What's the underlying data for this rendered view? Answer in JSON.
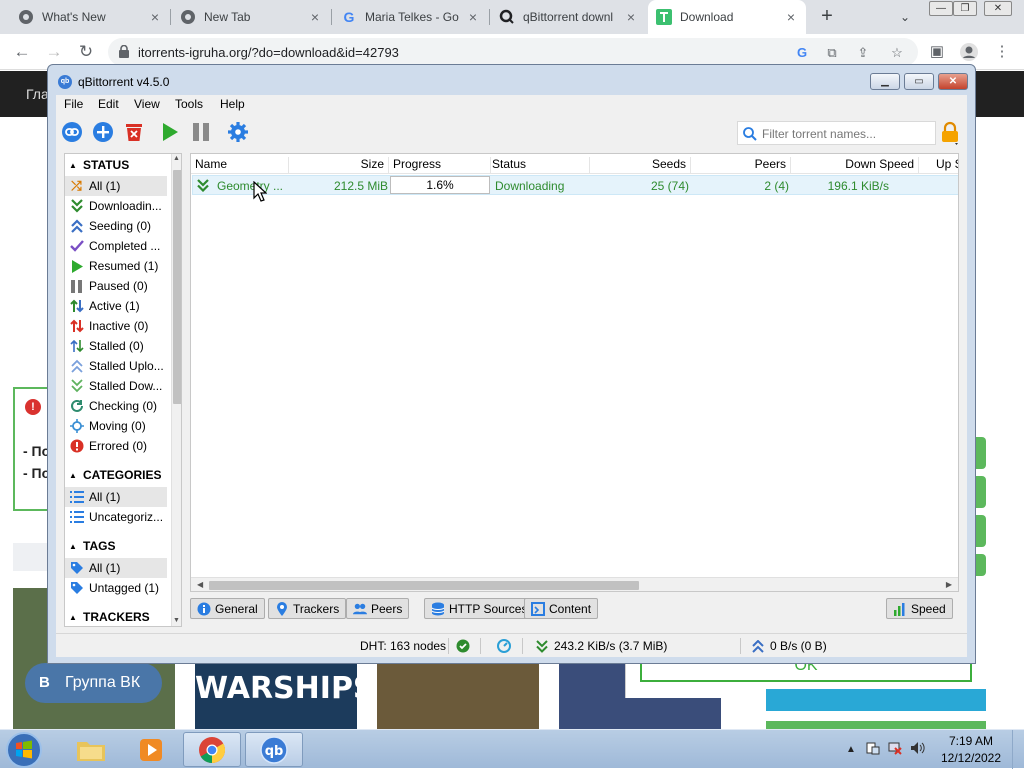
{
  "browser": {
    "tabs": [
      {
        "title": "What's New",
        "icon": "chrome-icon"
      },
      {
        "title": "New Tab",
        "icon": "chrome-icon"
      },
      {
        "title": "Maria Telkes - Go",
        "icon": "google-icon"
      },
      {
        "title": "qBittorrent downl",
        "icon": "search-icon"
      },
      {
        "title": "Download",
        "icon": "site-icon"
      }
    ],
    "new_tab_label": "+",
    "tab_menu_label": "⌄",
    "url": "itorrents-igruha.org/?do=download&id=42793"
  },
  "webpage": {
    "nav_text": "Гла",
    "err_lines": [
      "- По",
      "- По"
    ],
    "vk_label": "Группа ВК",
    "vk_icon": "В",
    "warships": "WARSHIPS",
    "ok_label": "OK"
  },
  "qb": {
    "title": "qBittorrent v4.5.0",
    "menu": [
      "File",
      "Edit",
      "View",
      "Tools",
      "Help"
    ],
    "filter_placeholder": "Filter torrent names...",
    "sidebar": {
      "status_header": "STATUS",
      "status_items": [
        {
          "label": "All (1)",
          "icon": "all-icon",
          "color": "#d97a00"
        },
        {
          "label": "Downloadin...",
          "icon": "download-icon",
          "color": "#2e8b2e"
        },
        {
          "label": "Seeding (0)",
          "icon": "upload-icon",
          "color": "#3a6fc4"
        },
        {
          "label": "Completed ...",
          "icon": "check-icon",
          "color": "#7a4fc4"
        },
        {
          "label": "Resumed (1)",
          "icon": "play-icon",
          "color": "#2eaa2e"
        },
        {
          "label": "Paused (0)",
          "icon": "pause-icon",
          "color": "#777777"
        },
        {
          "label": "Active (1)",
          "icon": "active-icon",
          "color": "#2e8b2e"
        },
        {
          "label": "Inactive (0)",
          "icon": "inactive-icon",
          "color": "#d93025"
        },
        {
          "label": "Stalled (0)",
          "icon": "stalled-icon",
          "color": "#2e8b2e"
        },
        {
          "label": "Stalled Uplo...",
          "icon": "stalled-upload-icon",
          "color": "#3a6fc4"
        },
        {
          "label": "Stalled Dow...",
          "icon": "stalled-download-icon",
          "color": "#2e8b2e"
        },
        {
          "label": "Checking (0)",
          "icon": "checking-icon",
          "color": "#2e8b6e"
        },
        {
          "label": "Moving (0)",
          "icon": "moving-icon",
          "color": "#3a8fd4"
        },
        {
          "label": "Errored (0)",
          "icon": "error-icon",
          "color": "#d93025"
        }
      ],
      "categories_header": "CATEGORIES",
      "categories_items": [
        {
          "label": "All (1)",
          "icon": "list-icon"
        },
        {
          "label": "Uncategoriz...",
          "icon": "list-icon"
        }
      ],
      "tags_header": "TAGS",
      "tags_items": [
        {
          "label": "All (1)",
          "icon": "tag-icon"
        },
        {
          "label": "Untagged (1)",
          "icon": "tag-icon"
        }
      ],
      "trackers_header": "TRACKERS"
    },
    "table": {
      "columns": [
        "Name",
        "Size",
        "Progress",
        "Status",
        "Seeds",
        "Peers",
        "Down Speed",
        "Up S"
      ],
      "rows": [
        {
          "name": "Geometry ...",
          "size": "212.5 MiB",
          "progress": "1.6%",
          "status": "Downloading",
          "seeds": "25 (74)",
          "peers": "2 (4)",
          "down_speed": "196.1 KiB/s"
        }
      ]
    },
    "bottom_tabs": [
      "General",
      "Trackers",
      "Peers",
      "HTTP Sources",
      "Content"
    ],
    "speed_tab": "Speed",
    "statusbar": {
      "dht": "DHT: 163 nodes",
      "download": "243.2 KiB/s (3.7 MiB)",
      "upload": "0 B/s (0 B)"
    }
  },
  "taskbar": {
    "time": "7:19 AM",
    "date": "12/12/2022"
  }
}
